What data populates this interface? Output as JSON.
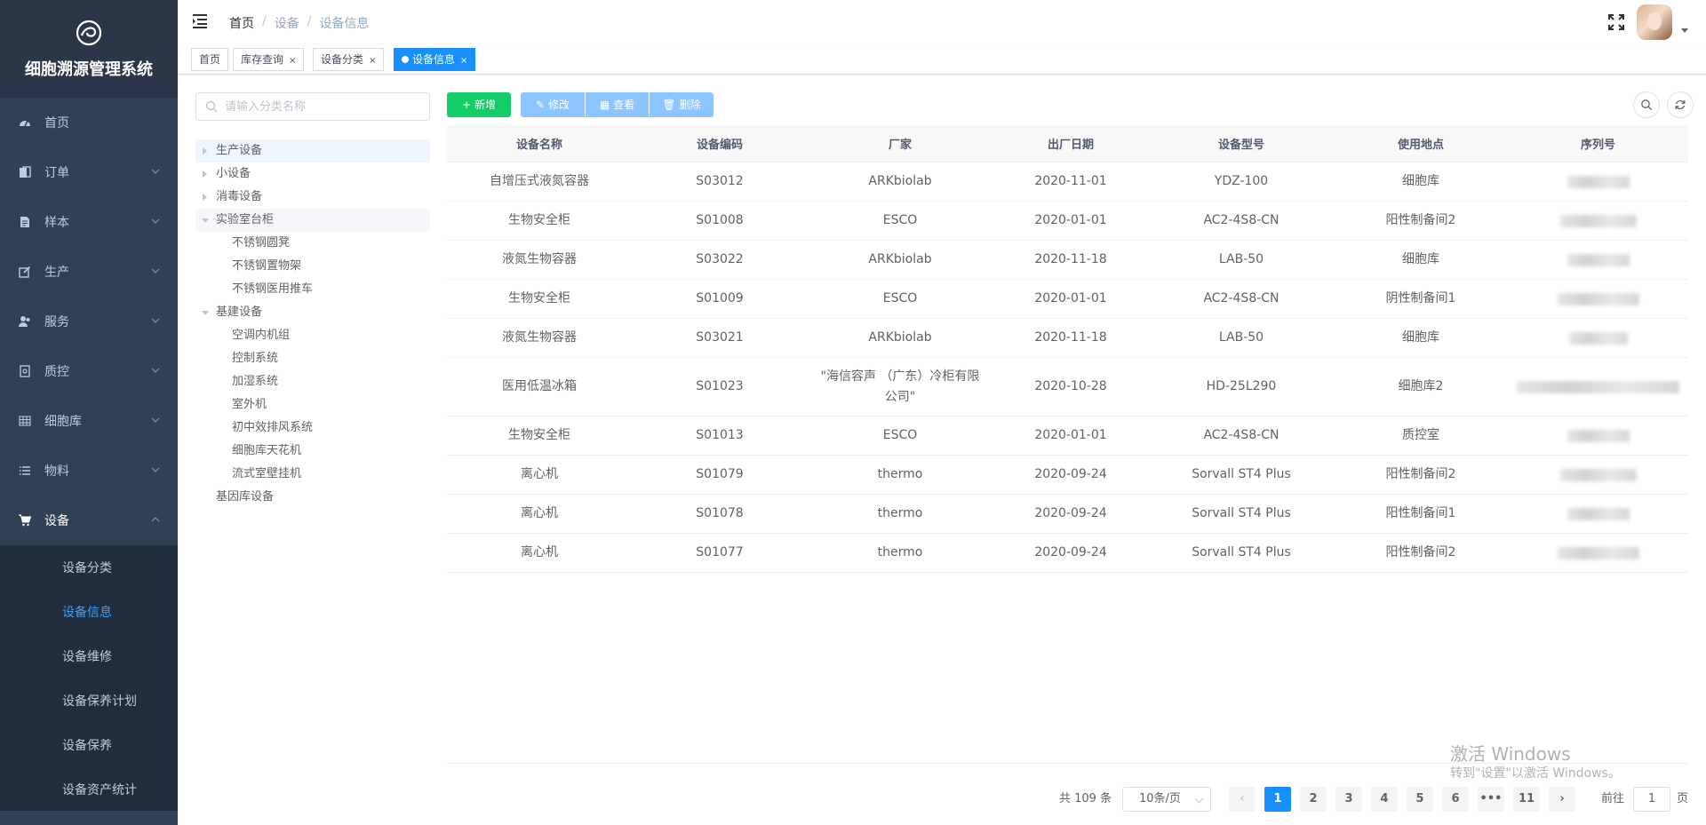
{
  "app": {
    "title": "细胞溯源管理系统"
  },
  "colors": {
    "sidebar_bg": "#304156",
    "accent": "#1890ff",
    "add_button": "#13ce66",
    "action_buttons": "#8cc5ff"
  },
  "sidebar": {
    "items": [
      {
        "label": "首页",
        "icon": "dashboard-icon"
      },
      {
        "label": "订单",
        "icon": "order-icon"
      },
      {
        "label": "样本",
        "icon": "document-icon"
      },
      {
        "label": "生产",
        "icon": "edit-icon"
      },
      {
        "label": "服务",
        "icon": "people-icon"
      },
      {
        "label": "质控",
        "icon": "qc-icon"
      },
      {
        "label": "细胞库",
        "icon": "grid-icon"
      },
      {
        "label": "物料",
        "icon": "list-icon"
      },
      {
        "label": "设备",
        "icon": "cart-icon"
      }
    ],
    "sub_items": [
      "设备分类",
      "设备信息",
      "设备维修",
      "设备保养计划",
      "设备保养",
      "设备资产统计"
    ]
  },
  "breadcrumb": [
    "首页",
    "设备",
    "设备信息"
  ],
  "tags": [
    "首页",
    "库存查询",
    "设备分类",
    "设备信息"
  ],
  "tree": {
    "placeholder": "请输入分类名称",
    "nodes": [
      {
        "label": "生产设备"
      },
      {
        "label": "小设备"
      },
      {
        "label": "消毒设备"
      },
      {
        "label": "实验室台柜"
      },
      {
        "label": "不锈钢圆凳"
      },
      {
        "label": "不锈钢置物架"
      },
      {
        "label": "不锈钢医用推车"
      },
      {
        "label": "基建设备"
      },
      {
        "label": "空调内机组"
      },
      {
        "label": "控制系统"
      },
      {
        "label": "加湿系统"
      },
      {
        "label": "室外机"
      },
      {
        "label": "初中效排风系统"
      },
      {
        "label": "细胞库天花机"
      },
      {
        "label": "流式室壁挂机"
      },
      {
        "label": "基因库设备"
      }
    ]
  },
  "toolbar": {
    "add": "新增",
    "edit": "修改",
    "view": "查看",
    "delete": "删除"
  },
  "table": {
    "headers": [
      "设备名称",
      "设备编码",
      "厂家",
      "出厂日期",
      "设备型号",
      "使用地点",
      "序列号"
    ],
    "rows": [
      {
        "name": "自增压式液氮容器",
        "code": "S03012",
        "maker": "ARKbiolab",
        "date": "2020-11-01",
        "model": "YDZ-100",
        "location": "细胞库"
      },
      {
        "name": "生物安全柜",
        "code": "S01008",
        "maker": "ESCO",
        "date": "2020-01-01",
        "model": "AC2-4S8-CN",
        "location": "阳性制备间2"
      },
      {
        "name": "液氮生物容器",
        "code": "S03022",
        "maker": "ARKbiolab",
        "date": "2020-11-18",
        "model": "LAB-50",
        "location": "细胞库"
      },
      {
        "name": "生物安全柜",
        "code": "S01009",
        "maker": "ESCO",
        "date": "2020-01-01",
        "model": "AC2-4S8-CN",
        "location": "阴性制备间1"
      },
      {
        "name": "液氮生物容器",
        "code": "S03021",
        "maker": "ARKbiolab",
        "date": "2020-11-18",
        "model": "LAB-50",
        "location": "细胞库"
      },
      {
        "name": "医用低温冰箱",
        "code": "S01023",
        "maker": "\"海信容声 （广东）冷柜有限公司\"",
        "date": "2020-10-28",
        "model": "HD-25L290",
        "location": "细胞库2"
      },
      {
        "name": "生物安全柜",
        "code": "S01013",
        "maker": "ESCO",
        "date": "2020-01-01",
        "model": "AC2-4S8-CN",
        "location": "质控室"
      },
      {
        "name": "离心机",
        "code": "S01079",
        "maker": "thermo",
        "date": "2020-09-24",
        "model": "Sorvall ST4 Plus",
        "location": "阳性制备间2"
      },
      {
        "name": "离心机",
        "code": "S01078",
        "maker": "thermo",
        "date": "2020-09-24",
        "model": "Sorvall ST4 Plus",
        "location": "阳性制备间1"
      },
      {
        "name": "离心机",
        "code": "S01077",
        "maker": "thermo",
        "date": "2020-09-24",
        "model": "Sorvall ST4 Plus",
        "location": "阳性制备间2"
      }
    ]
  },
  "pagination": {
    "total": "共 109 条",
    "page_size": "10条/页",
    "pages": [
      "1",
      "2",
      "3",
      "4",
      "5",
      "6",
      "•••",
      "11"
    ],
    "current": "1",
    "goto_label": "前往",
    "goto_value": "1",
    "page_suffix": "页"
  },
  "watermark": {
    "line1": "激活 Windows",
    "line2": "转到\"设置\"以激活 Windows。"
  }
}
